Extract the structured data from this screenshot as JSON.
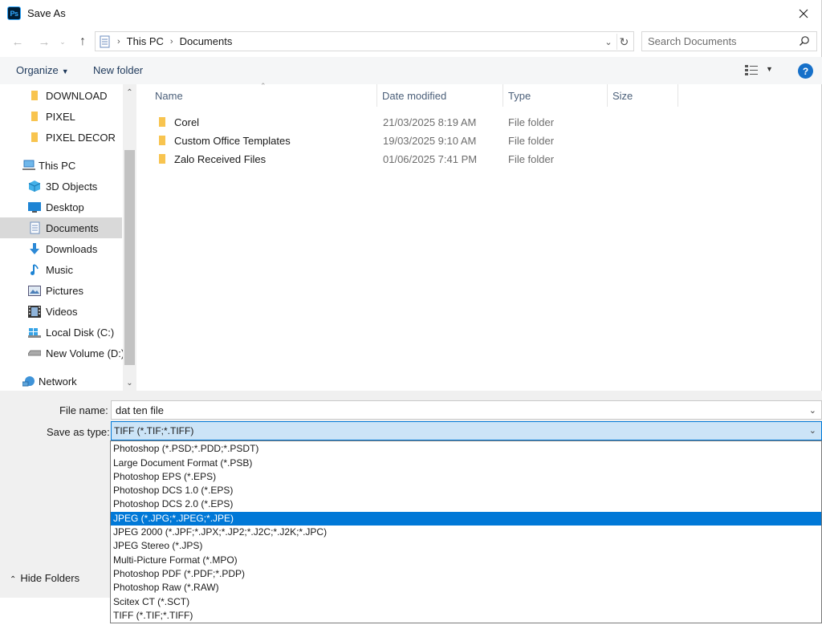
{
  "window": {
    "title": "Save As",
    "app_icon_text": "Ps"
  },
  "address": {
    "breadcrumbs": [
      "This PC",
      "Documents"
    ],
    "search_placeholder": "Search Documents"
  },
  "toolbar": {
    "organize": "Organize",
    "new_folder": "New folder"
  },
  "navpane": {
    "items": [
      {
        "label": "DOWNLOAD",
        "icon": "folder-icon"
      },
      {
        "label": "PIXEL",
        "icon": "folder-icon"
      },
      {
        "label": "PIXEL DECOR",
        "icon": "folder-icon"
      },
      {
        "label": "This PC",
        "icon": "this-pc-icon"
      },
      {
        "label": "3D Objects",
        "icon": "3d-objects-icon"
      },
      {
        "label": "Desktop",
        "icon": "desktop-icon"
      },
      {
        "label": "Documents",
        "icon": "documents-icon",
        "selected": true
      },
      {
        "label": "Downloads",
        "icon": "downloads-icon"
      },
      {
        "label": "Music",
        "icon": "music-icon"
      },
      {
        "label": "Pictures",
        "icon": "pictures-icon"
      },
      {
        "label": "Videos",
        "icon": "videos-icon"
      },
      {
        "label": "Local Disk (C:)",
        "icon": "local-disk-icon"
      },
      {
        "label": "New Volume (D:)",
        "icon": "drive-icon"
      },
      {
        "label": "Network",
        "icon": "network-icon"
      }
    ]
  },
  "filelist": {
    "columns": [
      "Name",
      "Date modified",
      "Type",
      "Size"
    ],
    "rows": [
      {
        "name": "Corel",
        "date": "21/03/2025 8:19 AM",
        "type": "File folder"
      },
      {
        "name": "Custom Office Templates",
        "date": "19/03/2025 9:10 AM",
        "type": "File folder"
      },
      {
        "name": "Zalo Received Files",
        "date": "01/06/2025 7:41 PM",
        "type": "File folder"
      }
    ]
  },
  "form": {
    "file_name_label": "File name:",
    "file_name_value": "dat ten file",
    "save_as_type_label": "Save as type:",
    "save_as_type_value": "TIFF (*.TIF;*.TIFF)"
  },
  "dropdown": {
    "options": [
      "Photoshop (*.PSD;*.PDD;*.PSDT)",
      "Large Document Format (*.PSB)",
      "Photoshop EPS (*.EPS)",
      "Photoshop DCS 1.0 (*.EPS)",
      "Photoshop DCS 2.0 (*.EPS)",
      "JPEG (*.JPG;*.JPEG;*.JPE)",
      "JPEG 2000 (*.JPF;*.JPX;*.JP2;*.J2C;*.J2K;*.JPC)",
      "JPEG Stereo (*.JPS)",
      "Multi-Picture Format (*.MPO)",
      "Photoshop PDF (*.PDF;*.PDP)",
      "Photoshop Raw (*.RAW)",
      "Scitex CT (*.SCT)",
      "TIFF (*.TIF;*.TIFF)"
    ],
    "highlighted": "JPEG (*.JPG;*.JPEG;*.JPE)"
  },
  "footer": {
    "hide_folders": "Hide Folders"
  },
  "colors": {
    "accent": "#0078d7",
    "selection": "#cce4f7",
    "folder": "#f8c44f",
    "help": "#1670c9"
  }
}
